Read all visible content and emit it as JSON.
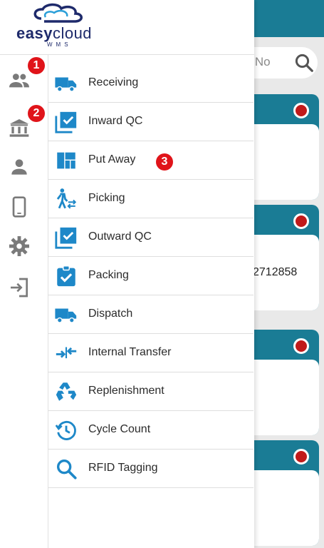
{
  "app": {
    "logo_word_1": "easy",
    "logo_word_2": "cloud",
    "logo_sub": "WMS",
    "accent_color": "#1a7c95",
    "icon_color": "#1e88c8"
  },
  "background": {
    "search_placeholder": "ef No",
    "card_text": "2712858"
  },
  "badges": {
    "one": "1",
    "two": "2",
    "three": "3"
  },
  "rail": [
    {
      "icon": "people-icon"
    },
    {
      "icon": "bank-icon"
    },
    {
      "icon": "person-icon"
    },
    {
      "icon": "mobile-icon"
    },
    {
      "icon": "settings-icon"
    },
    {
      "icon": "logout-icon"
    }
  ],
  "menu": [
    {
      "label": "Receiving",
      "icon": "truck-icon"
    },
    {
      "label": "Inward QC",
      "icon": "checklist-icon"
    },
    {
      "label": "Put Away",
      "icon": "grid-icon"
    },
    {
      "label": "Picking",
      "icon": "picking-icon"
    },
    {
      "label": "Outward QC",
      "icon": "checklist-icon"
    },
    {
      "label": "Packing",
      "icon": "clipboard-check-icon"
    },
    {
      "label": "Dispatch",
      "icon": "truck-icon"
    },
    {
      "label": "Internal Transfer",
      "icon": "transfer-icon"
    },
    {
      "label": "Replenishment",
      "icon": "recycle-icon"
    },
    {
      "label": "Cycle Count",
      "icon": "history-icon"
    },
    {
      "label": "RFID Tagging",
      "icon": "search-icon"
    }
  ]
}
